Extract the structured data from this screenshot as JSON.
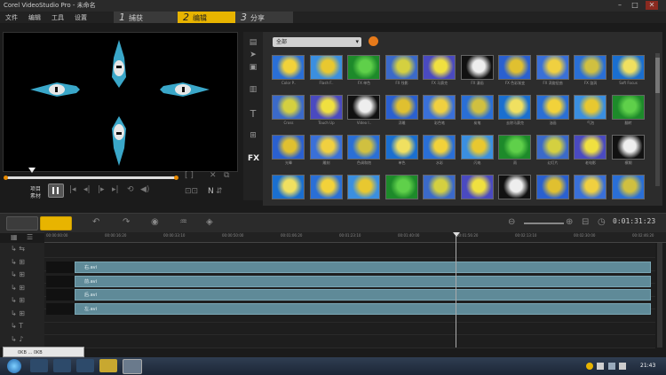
{
  "window": {
    "title": "Corel VideoStudio Pro - 未命名",
    "controls": [
      "–",
      "□",
      "✕"
    ]
  },
  "menu": {
    "items": [
      "文件",
      "编辑",
      "工具",
      "设置"
    ]
  },
  "steps": [
    {
      "num": "1",
      "label": "捕获"
    },
    {
      "num": "2",
      "label": "编辑"
    },
    {
      "num": "3",
      "label": "分享"
    }
  ],
  "player": {
    "mode_project": "项目",
    "mode_clip": "素材",
    "brackets": "[ ]",
    "controls_right": "N"
  },
  "library": {
    "category": "全部",
    "fx_label": "FX",
    "thumbs": [
      [
        "Color P..",
        "Flash F..",
        "FX 单色",
        "FX 残影",
        "FX 马赛克",
        "FX 漫画",
        "FX 色彩渐变",
        "FX 涡旋扭曲",
        "FX 漩涡",
        "Soft Focus"
      ],
      [
        "Cross",
        "Touch Up",
        "Video I..",
        "浮雕",
        "彩色笔",
        "炭笔",
        "去除马赛克",
        "油画",
        "气泡",
        "翻转"
      ],
      [
        "光晕",
        "雕刻",
        "色调和饱",
        "单色",
        "水彩",
        "闪电",
        "雨",
        "幻灯片",
        "老电影",
        "模糊"
      ],
      [
        "",
        "",
        "",
        "",
        "",
        "",
        "",
        "",
        "",
        ""
      ]
    ]
  },
  "timeline": {
    "timecode": "0:01:31:23",
    "ruler_labels": [
      "00:00:00:00",
      "00:00:16:20",
      "00:00:33:10",
      "00:00:50:00",
      "00:01:06:20",
      "00:01:23:10",
      "00:01:40:00",
      "00:01:56:20",
      "00:02:13:10",
      "00:02:30:00",
      "00:02:46:20"
    ],
    "clips": [
      "右.avi",
      "前.avi",
      "后.avi",
      "左.avi"
    ]
  },
  "popup": {
    "text": "0KB ... 0KB"
  },
  "taskbar": {
    "clock": "21:43"
  },
  "colors": {
    "accent": "#e8b400",
    "clip": "#5f8a98",
    "orange": "#e67a1a"
  }
}
